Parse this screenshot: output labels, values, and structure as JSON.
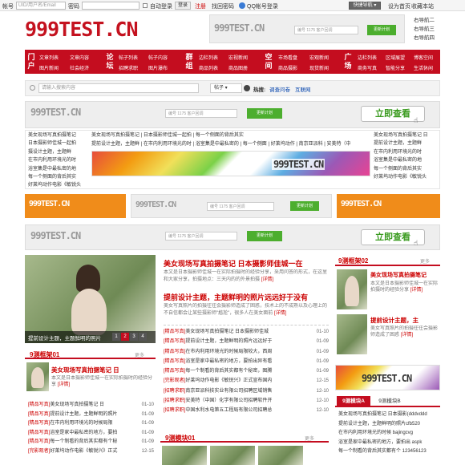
{
  "topbar": {
    "account_label": "帐号",
    "account_placeholder": "UID/用户名/Email",
    "password_label": "密码",
    "auto_login": "自动登录",
    "login": "登录",
    "register": "注册",
    "find_password": "找回密码",
    "qq_login": "QQ帐号登录",
    "quick_nav": "快捷导航",
    "set_home": "设为首页",
    "bookmark": "收藏本站"
  },
  "brand": {
    "logo": "999TEST.CN",
    "colors": {
      "primary": "#c40d1f",
      "green": "#4cae2e",
      "link_blue": "#0645ad"
    }
  },
  "header_ad": {
    "logo": "999TEST.CN",
    "placeholder": "编号 1175 客户回调",
    "button": "更新计划"
  },
  "right_links": [
    "右导航二",
    "右导航三",
    "右导航四"
  ],
  "nav": {
    "groups": [
      {
        "cat": [
          "门",
          "户"
        ],
        "links": [
          [
            "文章列表",
            "文章内容"
          ],
          [
            "图片新闻",
            "社会经济"
          ]
        ]
      },
      {
        "cat": [
          "论",
          "坛"
        ],
        "links": [
          [
            "帖子列表",
            "帖子内容"
          ],
          [
            "招聘求职",
            "图片瀑布"
          ]
        ]
      },
      {
        "cat": [
          "群",
          "组"
        ],
        "links": [
          [
            "边栏列表",
            "宏视新闻"
          ],
          [
            "商品列表",
            "商品图册"
          ]
        ]
      },
      {
        "cat": [
          "空",
          "间"
        ],
        "links": [
          [
            "市场看盘",
            "宏观新闻"
          ],
          [
            "商品摄影",
            "现货新闻"
          ]
        ]
      },
      {
        "cat": [
          "广",
          "场"
        ],
        "links": [
          [
            "边栏列表",
            "区域展望"
          ],
          [
            "商务写真",
            "智能分享"
          ]
        ]
      }
    ],
    "extra": [
      [
        "博客空间"
      ],
      [
        "生活休闲"
      ]
    ]
  },
  "search": {
    "placeholder": "请输入搜索内容",
    "type": "帖子",
    "hot_label": "热搜:",
    "hot_links": [
      "调查问卷",
      "互联网"
    ]
  },
  "ad_band1": {
    "logo": "999TEST.CN",
    "placeholder": "编号 1175 客户回调",
    "button": "更新计划",
    "look": "立即查看"
  },
  "text_ad": {
    "left": [
      "美女现场写真拍摄笔记",
      "日本摄影师佳城一起拍",
      "摄设计主题，主题鲜",
      "在市内利用环境光的时",
      "浴室集是中最私密的地",
      "每一个侧面的背后其实",
      "好莱坞动作电影《敏锐头"
    ],
    "center": [
      "美女现场写真拍摄笔记",
      "日本摄影师佳城一起拍",
      "每一个侧面的背后其实",
      "提前设计主题，主题鲜",
      "在市内利用环境光的时",
      "浴室集是中最私密的",
      "每一个侧面",
      "好莱坞动作",
      "南京亚派科",
      "安美特（中"
    ],
    "right": [
      "美女现场写真拍摄笔记 日",
      "提前设计主题，主题鲜",
      "在市内利用环境光的时",
      "浴室集是中最私密的地",
      "每一个侧面的背后其实",
      "好莱坞动作电影《敏锐头"
    ]
  },
  "banner_row": [
    {
      "logo": "999TEST.CN"
    },
    {
      "logo": "999TEST.CN",
      "placeholder": "编号 1175 客户回调",
      "button": "更新计划"
    },
    {
      "logo": "999TEST.CN"
    }
  ],
  "ad_band2": {
    "logo": "999TEST.CN",
    "placeholder": "编号 1175 客户回调",
    "button": "更新计划",
    "look": "立即查看"
  },
  "slider": {
    "caption": "提前设计主题，主题鲜明的照片",
    "pages": [
      "1",
      "2",
      "3",
      "4"
    ],
    "active": 2
  },
  "headline": {
    "title": "美女现场写真拍摄笔记 日本摄影师佳城一在",
    "summary": "本文是日本摄影师佳城一在实际拍摄时的经验分享，采用问答的形式，在这里和大家分享，拍摄地点：三天内的的外景拍摄",
    "more": "[详情]"
  },
  "headline2": {
    "title": "提前设计主题，主题鲜明的照片远远好于没有",
    "summary": "美女写真照片的拍摄往往会摄影师造成了困惑，技术上的不成熟以及心理上的不自信都会让某些摄影师\"尴尬\"，很多人在美女面前",
    "more": "[详情]"
  },
  "mid_list": [
    {
      "tag": "[精品写真]",
      "text": "美女现场写真拍摄笔记 日本摄影师佳城",
      "date": "01-10"
    },
    {
      "tag": "[精品写真]",
      "text": "提前设计主题，主题鲜明的照片远远好于",
      "date": "01-09"
    },
    {
      "tag": "[精品写真]",
      "text": "在市内利用环境光的时候局限较大，西周",
      "date": "01-09"
    },
    {
      "tag": "[精品写真]",
      "text": "浴室是家中最私密的地方，要拍出异有看",
      "date": "01-09"
    },
    {
      "tag": "[精品写真]",
      "text": "每一个制看的背后其实都有个秘密，图腾",
      "date": "01-09"
    },
    {
      "tag": "[完影观者]",
      "text": "好莱坞动作电影《敏锐兴》正式宣布国内",
      "date": "12-15"
    },
    {
      "tag": "[招聘求职]",
      "text": "南京亚派科技实业有限公司招聘区域销售",
      "date": "12-10"
    },
    {
      "tag": "[招聘求职]",
      "text": "安美特（中国）化学有限公司招聘软件开",
      "date": "12-10"
    },
    {
      "tag": "[招聘求职]",
      "text": "中国水利水电第五工程局有限公司招聘总",
      "date": "12-10"
    }
  ],
  "frame1": {
    "title": "9测框架01",
    "more": "更多",
    "feature_title": "美女现场写真拍摄笔记 日",
    "feature_summary": "本文是日本摄影师佳城一在实际拍摄时的经验分享",
    "more2": "[详情]",
    "list": [
      {
        "tag": "[精品写真]",
        "text": "美女现场写真拍摄笔记 日",
        "date": "01-10"
      },
      {
        "tag": "[精品写真]",
        "text": "提前设计主题，主题鲜明的照片",
        "date": "01-09"
      },
      {
        "tag": "[精品写真]",
        "text": "在市内利用环境光的时候局限",
        "date": "01-09"
      },
      {
        "tag": "[精品写真]",
        "text": "浴室是家中最私密的地方，要拍",
        "date": "01-09"
      },
      {
        "tag": "[精品写真]",
        "text": "每一个制看的背后其实都有个秘",
        "date": "01-09"
      },
      {
        "tag": "[完影观者]",
        "text": "好莱坞动作电影《敏锐兴》正式",
        "date": "12-15"
      }
    ]
  },
  "module1": {
    "title": "9测模块01",
    "more": "更多"
  },
  "right_frame": {
    "title": "9测框架02",
    "more": "更多",
    "item1_title": "美女现场写真拍摄笔记",
    "item1_summary": "本文是日本摄影师佳城一在实际拍摄时的经验分享",
    "item1_more": "[详情]",
    "item2_title": "提前设计主题，主",
    "item2_summary": "美女写真照片的拍摄往往会摄影师造成了困惑",
    "item2_more": "[详情]"
  },
  "right_banner": {
    "logo": "999TEST.CN"
  },
  "tabs": {
    "items": [
      "9测模块A",
      "9测模块B"
    ],
    "active": 0,
    "list": [
      "美女现场写真拍摄笔记 日本摄影(dddvddd",
      "提前设计主题，主题鲜明的照片cfb520",
      "在市内利用环境光的时候 bajingcvg",
      "浴室是家中最私密的地方，要拍出 aspk",
      "每一个制看的背后其实都有个 123456123"
    ]
  }
}
